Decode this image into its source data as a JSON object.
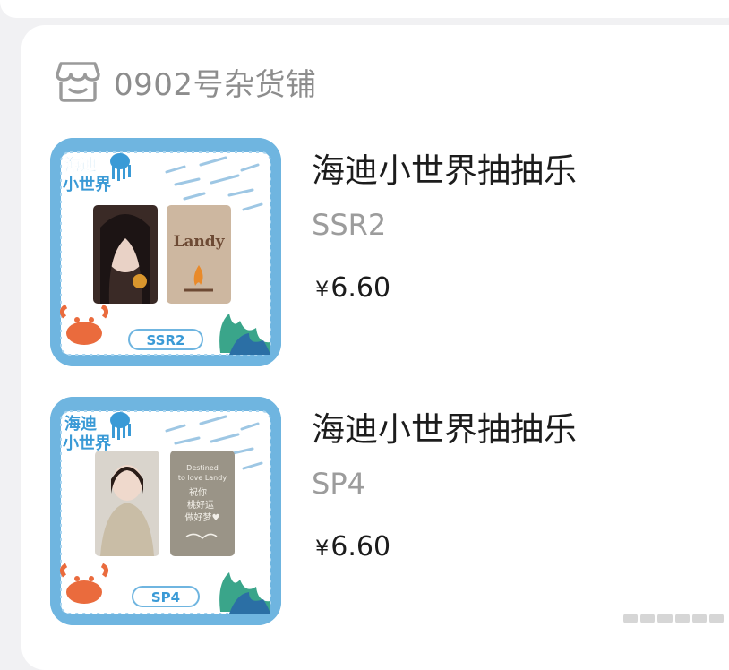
{
  "shop": {
    "name": "0902号杂货铺",
    "icon": "store-icon"
  },
  "items": [
    {
      "title": "海迪小世界抽抽乐",
      "subtitle": "SSR2",
      "currency": "¥",
      "price": "6.60",
      "thumbnail": {
        "brand": "海迪小世界",
        "tag": "SSR2",
        "card_title": "Landy"
      }
    },
    {
      "title": "海迪小世界抽抽乐",
      "subtitle": "SP4",
      "currency": "¥",
      "price": "6.60",
      "thumbnail": {
        "brand": "海迪小世界",
        "tag": "SP4",
        "card_lines": [
          "Destined",
          "to love Landy",
          "祝你",
          "桃好运",
          "做好梦♥"
        ]
      }
    }
  ]
}
